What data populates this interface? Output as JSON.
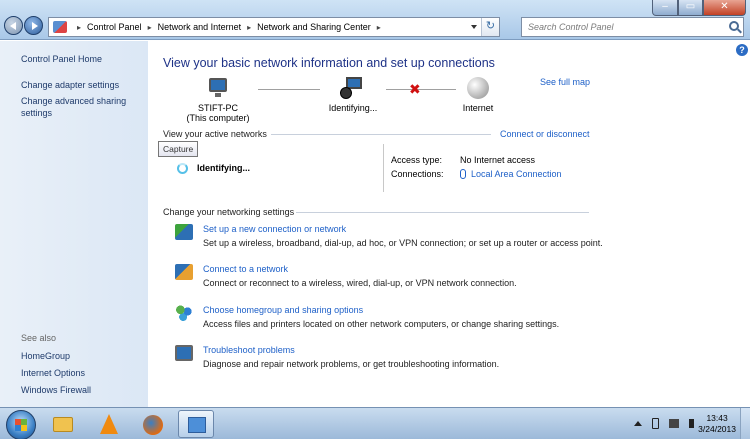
{
  "address_bar": {
    "crumbs": [
      "Control Panel",
      "Network and Internet",
      "Network and Sharing Center"
    ],
    "search_placeholder": "Search Control Panel"
  },
  "left_pane": {
    "home": "Control Panel Home",
    "adapter": "Change adapter settings",
    "advanced": "Change advanced sharing settings",
    "see_also_title": "See also",
    "see_also": [
      "HomeGroup",
      "Internet Options",
      "Windows Firewall"
    ]
  },
  "main": {
    "heading": "View your basic network information and set up connections",
    "see_full_map": "See full map",
    "nodes": {
      "computer_name": "STIFT-PC",
      "computer_sub": "(This computer)",
      "network": "Identifying...",
      "internet": "Internet"
    },
    "active_title": "View your active networks",
    "connect_disconnect": "Connect or disconnect",
    "tooltip": "Capture",
    "network_status": "Identifying...",
    "access_type_label": "Access type:",
    "access_type_value": "No Internet access",
    "connections_label": "Connections:",
    "connections_value": "Local Area Connection",
    "settings_title": "Change your networking settings",
    "tasks": [
      {
        "title": "Set up a new connection or network",
        "desc": "Set up a wireless, broadband, dial-up, ad hoc, or VPN connection; or set up a router or access point."
      },
      {
        "title": "Connect to a network",
        "desc": "Connect or reconnect to a wireless, wired, dial-up, or VPN network connection."
      },
      {
        "title": "Choose homegroup and sharing options",
        "desc": "Access files and printers located on other network computers, or change sharing settings."
      },
      {
        "title": "Troubleshoot problems",
        "desc": "Diagnose and repair network problems, or get troubleshooting information."
      }
    ]
  },
  "taskbar": {
    "time": "13:43",
    "date": "3/24/2013"
  },
  "colors": {
    "heading": "#1e3287",
    "link": "#1e60c8",
    "sidebar_bg": "#e1ebf7"
  },
  "icons": [
    "back-arrow-icon",
    "forward-arrow-icon",
    "refresh-icon",
    "search-icon",
    "computer-icon",
    "network-icon",
    "globe-icon",
    "spinner-icon",
    "ethernet-icon",
    "new-connection-icon",
    "connect-network-icon",
    "homegroup-icon",
    "troubleshoot-icon",
    "windows-start-icon",
    "folder-icon",
    "vlc-icon",
    "firefox-icon",
    "control-panel-icon"
  ]
}
